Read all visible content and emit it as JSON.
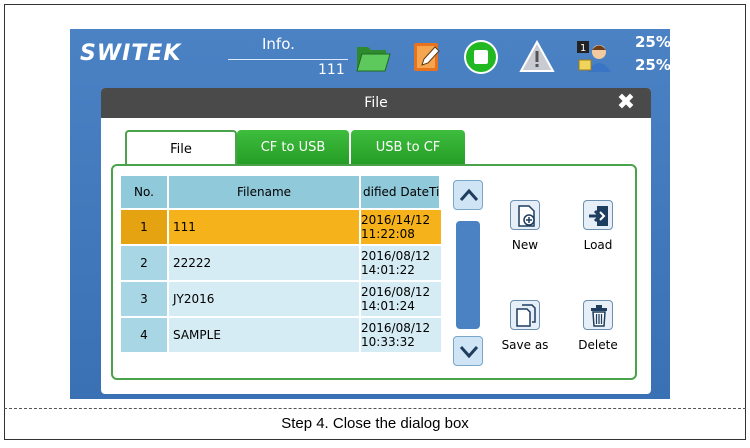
{
  "header": {
    "logo": "SWITEK",
    "info_label": "Info.",
    "info_value": "111",
    "percent_top": "25%",
    "percent_bottom": "25%",
    "icons": [
      "open-folder-icon",
      "edit-icon",
      "stop-icon",
      "warning-icon",
      "user-icon"
    ]
  },
  "dialog": {
    "title": "File",
    "tabs": [
      {
        "label": "File",
        "active": true
      },
      {
        "label": "CF to USB",
        "active": false
      },
      {
        "label": "USB to CF",
        "active": false
      }
    ],
    "table": {
      "headers": {
        "no": "No.",
        "filename": "Filename",
        "date": "dified DateTi"
      },
      "rows": [
        {
          "no": "1",
          "filename": "111",
          "date_line1": "2016/14/12",
          "date_line2": "11:22:08",
          "selected": true
        },
        {
          "no": "2",
          "filename": "22222",
          "date_line1": "2016/08/12",
          "date_line2": "14:01:22",
          "selected": false
        },
        {
          "no": "3",
          "filename": "JY2016",
          "date_line1": "2016/08/12",
          "date_line2": "14:01:24",
          "selected": false
        },
        {
          "no": "4",
          "filename": "SAMPLE",
          "date_line1": "2016/08/12",
          "date_line2": "10:33:32",
          "selected": false
        }
      ]
    },
    "actions": {
      "new": "New",
      "load": "Load",
      "save_as": "Save as",
      "delete": "Delete"
    }
  },
  "caption": "Step 4. Close the dialog box",
  "colors": {
    "screen_bg": "#4a82c4",
    "title_bar": "#4a4a4a",
    "tab_green": "#2fae2f",
    "selected_row": "#f5b21a",
    "row_light": "#d5ecf4",
    "header_cell": "#8fc9da"
  }
}
